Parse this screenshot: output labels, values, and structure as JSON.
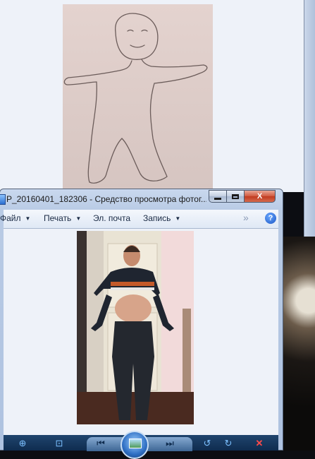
{
  "background_window": {},
  "window": {
    "title": "P_20160401_182306 - Средство просмотра фотог...",
    "caption_buttons": {
      "minimize_icon": "minimize-icon",
      "maximize_icon": "maximize-icon",
      "close_label": "X"
    }
  },
  "menu": {
    "items": [
      {
        "label": "Файл",
        "has_arrow": true
      },
      {
        "label": "Печать",
        "has_arrow": true
      },
      {
        "label": "Эл. почта",
        "has_arrow": false
      },
      {
        "label": "Запись",
        "has_arrow": true
      }
    ],
    "more_glyph": "»",
    "help_glyph": "?"
  },
  "toolbar": {
    "zoom_glyph": "⊕",
    "fit_glyph": "⊡",
    "prev_glyph": "⏮",
    "next_glyph": "⏭",
    "rotate_left_glyph": "↺",
    "rotate_right_glyph": "↻",
    "delete_glyph": "✕"
  },
  "colors": {
    "accent": "#1b56c4",
    "close": "#c0391f",
    "toolbar": "#0f2c4f"
  }
}
